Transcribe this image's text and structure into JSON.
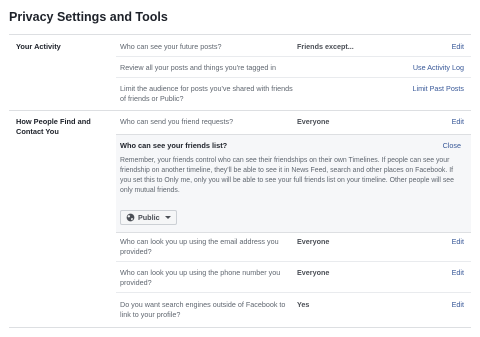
{
  "header": {
    "title": "Privacy Settings and Tools"
  },
  "sections": {
    "activity": {
      "label": "Your Activity",
      "rows": [
        {
          "question": "Who can see your future posts?",
          "value": "Friends except...",
          "action": "Edit"
        },
        {
          "question": "Review all your posts and things you're tagged in",
          "value": "",
          "action": "Use Activity Log"
        },
        {
          "question": "Limit the audience for posts you've shared with friends of friends or Public?",
          "value": "",
          "action": "Limit Past Posts"
        }
      ]
    },
    "contact": {
      "label": "How People Find and Contact You",
      "rows": [
        {
          "question": "Who can send you friend requests?",
          "value": "Everyone",
          "action": "Edit"
        },
        {
          "question": "Who can look you up using the email address you provided?",
          "value": "Everyone",
          "action": "Edit"
        },
        {
          "question": "Who can look you up using the phone number you provided?",
          "value": "Everyone",
          "action": "Edit"
        },
        {
          "question": "Do you want search engines outside of Facebook to link to your profile?",
          "value": "Yes",
          "action": "Edit"
        }
      ]
    }
  },
  "expanded": {
    "title": "Who can see your friends list?",
    "close": "Close",
    "description": "Remember, your friends control who can see their friendships on their own Timelines. If people can see your friendship on another timeline, they'll be able to see it in News Feed, search and other places on Facebook. If you set this to Only me, only you will be able to see your full friends list on your timeline. Other people will see only mutual friends.",
    "audience": "Public",
    "audience_icon": "globe-icon"
  }
}
